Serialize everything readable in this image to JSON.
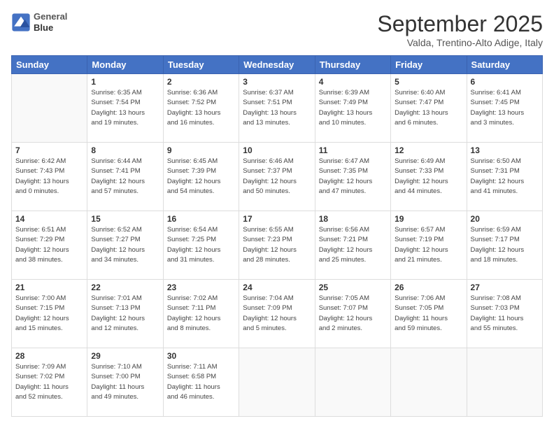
{
  "header": {
    "logo": {
      "line1": "General",
      "line2": "Blue"
    },
    "title": "September 2025",
    "subtitle": "Valda, Trentino-Alto Adige, Italy"
  },
  "days_of_week": [
    "Sunday",
    "Monday",
    "Tuesday",
    "Wednesday",
    "Thursday",
    "Friday",
    "Saturday"
  ],
  "weeks": [
    [
      {
        "day": "",
        "info": ""
      },
      {
        "day": "1",
        "info": "Sunrise: 6:35 AM\nSunset: 7:54 PM\nDaylight: 13 hours\nand 19 minutes."
      },
      {
        "day": "2",
        "info": "Sunrise: 6:36 AM\nSunset: 7:52 PM\nDaylight: 13 hours\nand 16 minutes."
      },
      {
        "day": "3",
        "info": "Sunrise: 6:37 AM\nSunset: 7:51 PM\nDaylight: 13 hours\nand 13 minutes."
      },
      {
        "day": "4",
        "info": "Sunrise: 6:39 AM\nSunset: 7:49 PM\nDaylight: 13 hours\nand 10 minutes."
      },
      {
        "day": "5",
        "info": "Sunrise: 6:40 AM\nSunset: 7:47 PM\nDaylight: 13 hours\nand 6 minutes."
      },
      {
        "day": "6",
        "info": "Sunrise: 6:41 AM\nSunset: 7:45 PM\nDaylight: 13 hours\nand 3 minutes."
      }
    ],
    [
      {
        "day": "7",
        "info": "Sunrise: 6:42 AM\nSunset: 7:43 PM\nDaylight: 13 hours\nand 0 minutes."
      },
      {
        "day": "8",
        "info": "Sunrise: 6:44 AM\nSunset: 7:41 PM\nDaylight: 12 hours\nand 57 minutes."
      },
      {
        "day": "9",
        "info": "Sunrise: 6:45 AM\nSunset: 7:39 PM\nDaylight: 12 hours\nand 54 minutes."
      },
      {
        "day": "10",
        "info": "Sunrise: 6:46 AM\nSunset: 7:37 PM\nDaylight: 12 hours\nand 50 minutes."
      },
      {
        "day": "11",
        "info": "Sunrise: 6:47 AM\nSunset: 7:35 PM\nDaylight: 12 hours\nand 47 minutes."
      },
      {
        "day": "12",
        "info": "Sunrise: 6:49 AM\nSunset: 7:33 PM\nDaylight: 12 hours\nand 44 minutes."
      },
      {
        "day": "13",
        "info": "Sunrise: 6:50 AM\nSunset: 7:31 PM\nDaylight: 12 hours\nand 41 minutes."
      }
    ],
    [
      {
        "day": "14",
        "info": "Sunrise: 6:51 AM\nSunset: 7:29 PM\nDaylight: 12 hours\nand 38 minutes."
      },
      {
        "day": "15",
        "info": "Sunrise: 6:52 AM\nSunset: 7:27 PM\nDaylight: 12 hours\nand 34 minutes."
      },
      {
        "day": "16",
        "info": "Sunrise: 6:54 AM\nSunset: 7:25 PM\nDaylight: 12 hours\nand 31 minutes."
      },
      {
        "day": "17",
        "info": "Sunrise: 6:55 AM\nSunset: 7:23 PM\nDaylight: 12 hours\nand 28 minutes."
      },
      {
        "day": "18",
        "info": "Sunrise: 6:56 AM\nSunset: 7:21 PM\nDaylight: 12 hours\nand 25 minutes."
      },
      {
        "day": "19",
        "info": "Sunrise: 6:57 AM\nSunset: 7:19 PM\nDaylight: 12 hours\nand 21 minutes."
      },
      {
        "day": "20",
        "info": "Sunrise: 6:59 AM\nSunset: 7:17 PM\nDaylight: 12 hours\nand 18 minutes."
      }
    ],
    [
      {
        "day": "21",
        "info": "Sunrise: 7:00 AM\nSunset: 7:15 PM\nDaylight: 12 hours\nand 15 minutes."
      },
      {
        "day": "22",
        "info": "Sunrise: 7:01 AM\nSunset: 7:13 PM\nDaylight: 12 hours\nand 12 minutes."
      },
      {
        "day": "23",
        "info": "Sunrise: 7:02 AM\nSunset: 7:11 PM\nDaylight: 12 hours\nand 8 minutes."
      },
      {
        "day": "24",
        "info": "Sunrise: 7:04 AM\nSunset: 7:09 PM\nDaylight: 12 hours\nand 5 minutes."
      },
      {
        "day": "25",
        "info": "Sunrise: 7:05 AM\nSunset: 7:07 PM\nDaylight: 12 hours\nand 2 minutes."
      },
      {
        "day": "26",
        "info": "Sunrise: 7:06 AM\nSunset: 7:05 PM\nDaylight: 11 hours\nand 59 minutes."
      },
      {
        "day": "27",
        "info": "Sunrise: 7:08 AM\nSunset: 7:03 PM\nDaylight: 11 hours\nand 55 minutes."
      }
    ],
    [
      {
        "day": "28",
        "info": "Sunrise: 7:09 AM\nSunset: 7:02 PM\nDaylight: 11 hours\nand 52 minutes."
      },
      {
        "day": "29",
        "info": "Sunrise: 7:10 AM\nSunset: 7:00 PM\nDaylight: 11 hours\nand 49 minutes."
      },
      {
        "day": "30",
        "info": "Sunrise: 7:11 AM\nSunset: 6:58 PM\nDaylight: 11 hours\nand 46 minutes."
      },
      {
        "day": "",
        "info": ""
      },
      {
        "day": "",
        "info": ""
      },
      {
        "day": "",
        "info": ""
      },
      {
        "day": "",
        "info": ""
      }
    ]
  ]
}
